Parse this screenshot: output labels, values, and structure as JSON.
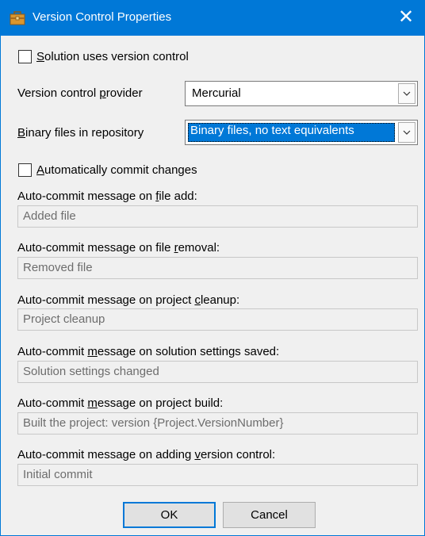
{
  "window": {
    "title": "Version Control Properties",
    "close_glyph": "✕"
  },
  "solution_uses_vc": {
    "prefix": "",
    "accel": "S",
    "rest": "olution uses version control",
    "checked": false
  },
  "provider": {
    "pre": "Version control ",
    "accel": "p",
    "post": "rovider",
    "value": "Mercurial"
  },
  "binary": {
    "pre": "",
    "accel": "B",
    "post": "inary files in repository",
    "value": "Binary files, no text equivalents"
  },
  "auto_commit": {
    "prefix": "",
    "accel": "A",
    "rest": "utomatically commit changes",
    "checked": false
  },
  "messages": [
    {
      "pre": "Auto-commit message on ",
      "accel": "f",
      "post": "ile add:",
      "value": "Added file"
    },
    {
      "pre": "Auto-commit message on file ",
      "accel": "r",
      "post": "emoval:",
      "value": "Removed file"
    },
    {
      "pre": "Auto-commit message on project ",
      "accel": "c",
      "post": "leanup:",
      "value": "Project cleanup"
    },
    {
      "pre": "Auto-commit ",
      "accel": "m",
      "post": "essage on solution settings saved:",
      "value": "Solution settings changed"
    },
    {
      "pre": "Auto-commit ",
      "accel": "m",
      "post": "essage on project build:",
      "value": "Built the project: version {Project.VersionNumber}"
    },
    {
      "pre": "Auto-commit message on adding ",
      "accel": "v",
      "post": "ersion control:",
      "value": "Initial commit"
    }
  ],
  "buttons": {
    "ok": "OK",
    "cancel": "Cancel"
  }
}
